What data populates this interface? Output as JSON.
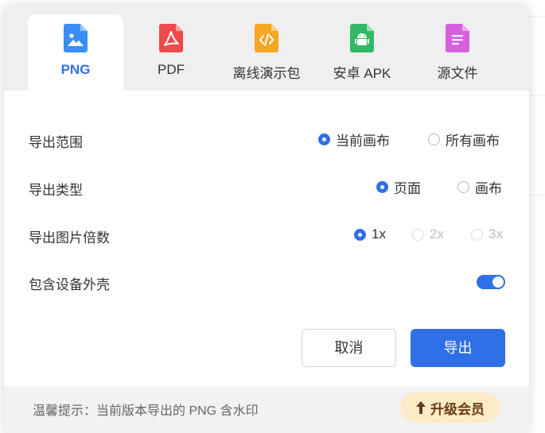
{
  "tabs": [
    {
      "label": "PNG",
      "icon": "image-file-icon",
      "color": "#3a8ef6"
    },
    {
      "label": "PDF",
      "icon": "pdf-file-icon",
      "color": "#ef4b4b"
    },
    {
      "label": "离线演示包",
      "icon": "code-file-icon",
      "color": "#f5a623"
    },
    {
      "label": "安卓 APK",
      "icon": "android-file-icon",
      "color": "#33b866"
    },
    {
      "label": "源文件",
      "icon": "document-file-icon",
      "color": "#d65ee0"
    }
  ],
  "options": {
    "range": {
      "label": "导出范围",
      "choices": [
        "当前画布",
        "所有画布"
      ],
      "selected": "当前画布"
    },
    "type": {
      "label": "导出类型",
      "choices": [
        "页面",
        "画布"
      ],
      "selected": "页面"
    },
    "scale": {
      "label": "导出图片倍数",
      "choices": [
        "1x",
        "2x",
        "3x"
      ],
      "selected": "1x"
    },
    "shell": {
      "label": "包含设备外壳",
      "enabled": true
    }
  },
  "buttons": {
    "cancel": "取消",
    "export": "导出"
  },
  "footer": {
    "tip": "温馨提示：当前版本导出的 PNG 含水印",
    "upgrade": "升级会员"
  },
  "colors": {
    "accent": "#2f6fe8",
    "upgrade_bg": "#fdebc8",
    "upgrade_text": "#6b3a12"
  }
}
